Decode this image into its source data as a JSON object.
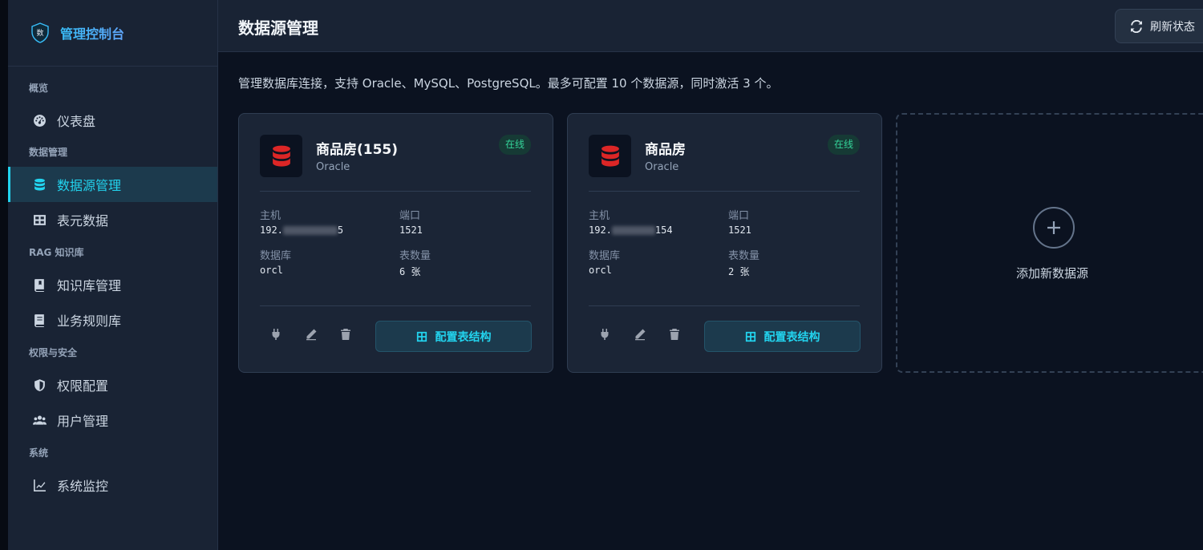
{
  "brand": {
    "title": "管理控制台",
    "logo_text": "数"
  },
  "sidebar": {
    "sections": [
      {
        "title": "概览",
        "items": [
          {
            "label": "仪表盘",
            "icon": "gauge-icon"
          }
        ]
      },
      {
        "title": "数据管理",
        "items": [
          {
            "label": "数据源管理",
            "icon": "database-icon",
            "active": true
          },
          {
            "label": "表元数据",
            "icon": "table-icon"
          }
        ]
      },
      {
        "title": "RAG 知识库",
        "items": [
          {
            "label": "知识库管理",
            "icon": "book-icon"
          },
          {
            "label": "业务规则库",
            "icon": "rules-book-icon"
          }
        ]
      },
      {
        "title": "权限与安全",
        "items": [
          {
            "label": "权限配置",
            "icon": "shield-icon"
          },
          {
            "label": "用户管理",
            "icon": "users-icon"
          }
        ]
      },
      {
        "title": "系统",
        "items": [
          {
            "label": "系统监控",
            "icon": "chart-line-icon"
          }
        ]
      }
    ]
  },
  "header": {
    "title": "数据源管理",
    "refresh_label": "刷新状态"
  },
  "main": {
    "description": "管理数据库连接，支持 Oracle、MySQL、PostgreSQL。最多可配置 10 个数据源，同时激活 3 个。",
    "cards": [
      {
        "name": "商品房(155)",
        "type": "Oracle",
        "status": "在线",
        "host_label": "主机",
        "host_prefix": "192.",
        "host_suffix": "5",
        "port_label": "端口",
        "port": "1521",
        "db_label": "数据库",
        "db": "orcl",
        "tables_label": "表数量",
        "tables": "6 张",
        "config_label": "配置表结构"
      },
      {
        "name": "商品房",
        "type": "Oracle",
        "status": "在线",
        "host_label": "主机",
        "host_prefix": "192.",
        "host_suffix": "154",
        "port_label": "端口",
        "port": "1521",
        "db_label": "数据库",
        "db": "orcl",
        "tables_label": "表数量",
        "tables": "2 张",
        "config_label": "配置表结构"
      }
    ],
    "add_label": "添加新数据源"
  },
  "colors": {
    "accent": "#22d3ee",
    "status_online": "#34d399",
    "db_icon": "#dc2626",
    "bg": "#0b1220",
    "panel": "#192334"
  }
}
